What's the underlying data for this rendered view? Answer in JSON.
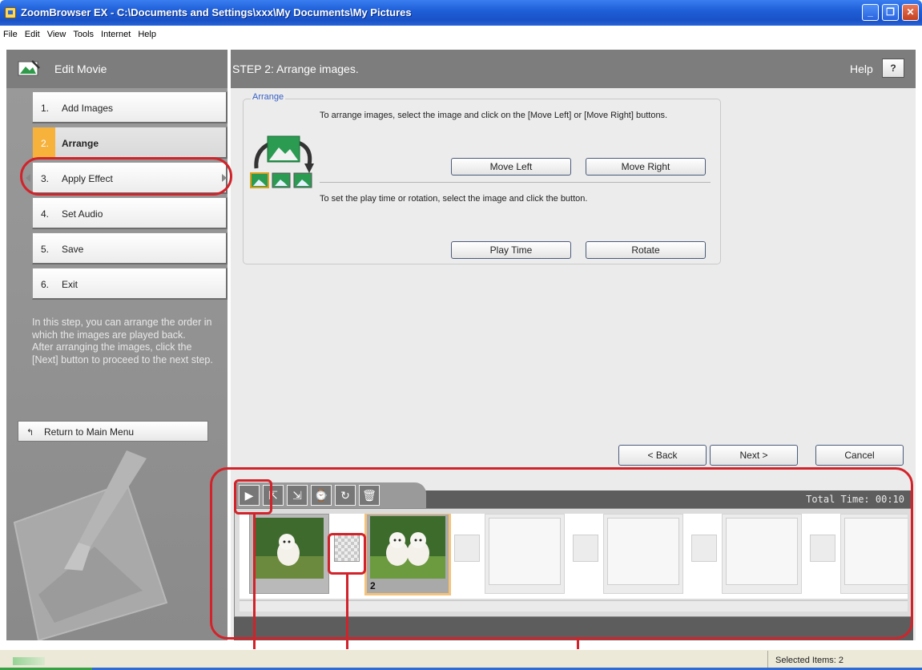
{
  "window": {
    "title": "ZoomBrowser EX  -  C:\\Documents and Settings\\xxx\\My Documents\\My Pictures",
    "minimize": "_",
    "maximize": "❐",
    "close": "✕"
  },
  "menu": [
    "File",
    "Edit",
    "View",
    "Tools",
    "Internet",
    "Help"
  ],
  "left_panel": {
    "title": "Edit Movie",
    "steps": [
      {
        "num": "1.",
        "label": "Add Images"
      },
      {
        "num": "2.",
        "label": "Arrange"
      },
      {
        "num": "3.",
        "label": "Apply Effect"
      },
      {
        "num": "4.",
        "label": "Set Audio"
      },
      {
        "num": "5.",
        "label": "Save"
      },
      {
        "num": "6.",
        "label": "Exit"
      }
    ],
    "description": "In this step, you can arrange the order in which the images are played back.\n After arranging the images, click the [Next] button to proceed to the next step.",
    "return_button": "Return to Main Menu"
  },
  "main": {
    "step_title": "STEP 2: Arrange images.",
    "help_label": "Help",
    "help_button": "?",
    "arrange": {
      "legend": "Arrange",
      "instruction_move": "To arrange images, select the image and click on the [Move Left] or [Move Right] buttons.",
      "move_left": "Move Left",
      "move_right": "Move Right",
      "instruction_play": "To set the play time or rotation, select the image and click the button.",
      "play_time": "Play Time",
      "rotate": "Rotate"
    },
    "nav": {
      "back": "< Back",
      "next": "Next >",
      "cancel": "Cancel"
    },
    "storyboard": {
      "play_icon": "▶",
      "total_time": "Total Time: 00:10",
      "selected_frame_number": "2"
    }
  },
  "status": {
    "selected_items": "Selected Items: 2"
  },
  "colors": {
    "active_step": "#f7b23b",
    "callout": "#d2232a",
    "title_bar": "#2763d8"
  }
}
